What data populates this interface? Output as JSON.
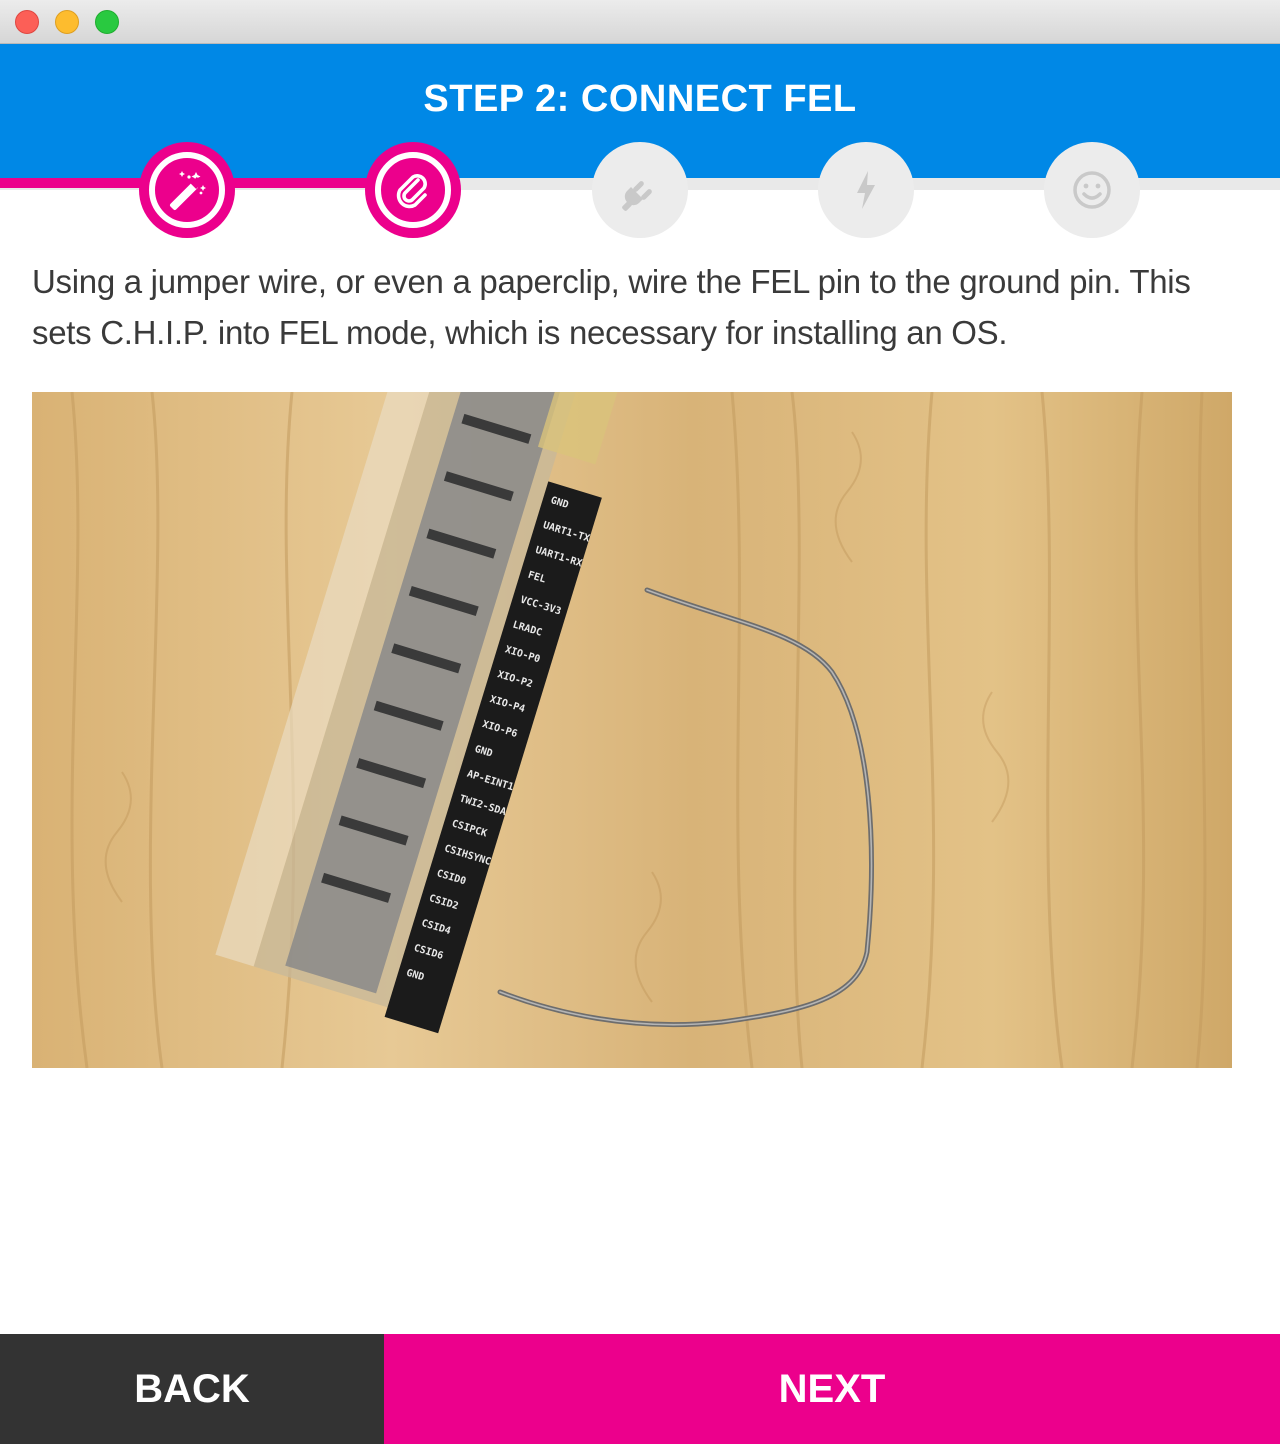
{
  "header": {
    "title": "STEP 2: CONNECT FEL"
  },
  "progress": {
    "current_step": 2,
    "total_steps": 5,
    "steps": [
      {
        "icon": "magic-wand-icon",
        "state": "complete"
      },
      {
        "icon": "paperclip-icon",
        "state": "current"
      },
      {
        "icon": "plug-icon",
        "state": "pending"
      },
      {
        "icon": "lightning-icon",
        "state": "pending"
      },
      {
        "icon": "smiley-icon",
        "state": "pending"
      }
    ]
  },
  "content": {
    "instructions": "Using a jumper wire, or even a paperclip, wire the FEL pin to the ground pin. This sets C.H.I.P. into FEL mode, which is necessary for installing an OS."
  },
  "photo": {
    "pin_labels": [
      "GND",
      "UART1-TX",
      "UART1-RX",
      "FEL",
      "VCC-3V3",
      "LRADC",
      "XIO-P0",
      "XIO-P2",
      "XIO-P4",
      "XIO-P6",
      "GND",
      "AP-EINT1",
      "TWI2-SDA",
      "CSIPCK",
      "CSIHSYNC",
      "CSID0",
      "CSID2",
      "CSID4",
      "CSID6",
      "GND"
    ]
  },
  "footer": {
    "back_label": "BACK",
    "next_label": "NEXT"
  },
  "colors": {
    "header_blue": "#0088e6",
    "accent_pink": "#ec008c",
    "back_dark": "#333333",
    "inactive_gray": "#ececec"
  }
}
